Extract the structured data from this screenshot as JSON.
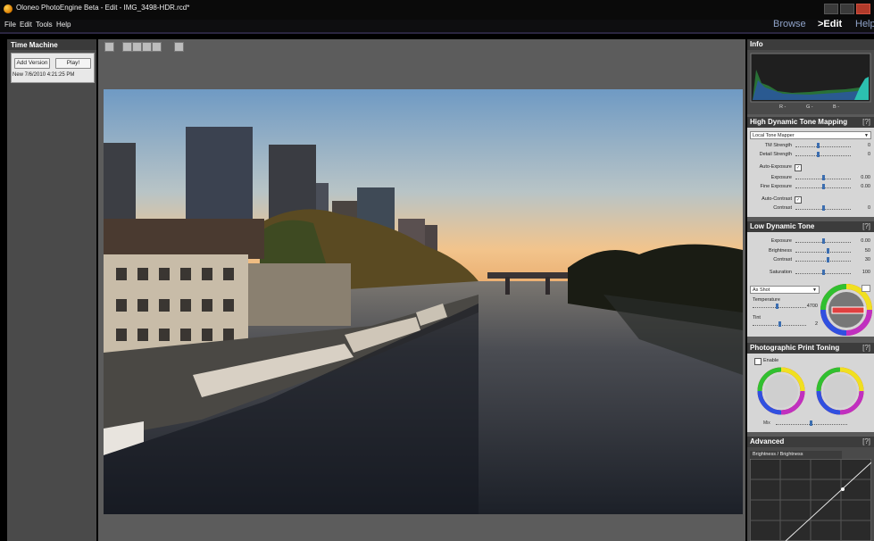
{
  "window": {
    "title": "Oloneo PhotoEngine Beta - Edit - IMG_3498-HDR.rcd*"
  },
  "menu": {
    "file": "File",
    "edit": "Edit",
    "tools": "Tools",
    "help": "Help"
  },
  "modes": {
    "browse": "Browse",
    "edit": ">Edit",
    "help": "Help"
  },
  "time_machine": {
    "title": "Time Machine",
    "add_version": "Add Version",
    "play": "Play!",
    "version_entry": "New 7/6/2010 4:21:25 PM"
  },
  "info": {
    "title": "Info",
    "hist_labels": [
      "R -",
      "G -",
      "B -"
    ]
  },
  "hdr": {
    "title": "High Dynamic Tone Mapping",
    "help": "[?]",
    "mapper": "Local Tone Mapper",
    "tm_strength": {
      "label": "TM Strength",
      "value": "0",
      "pos": 0.4
    },
    "detail_strength": {
      "label": "Detail Strength",
      "value": "0",
      "pos": 0.4
    },
    "auto_exposure": {
      "label": "Auto-Exposure",
      "checked": "✓"
    },
    "exposure": {
      "label": "Exposure",
      "value": "0.00",
      "pos": 0.5
    },
    "fine_exposure": {
      "label": "Fine Exposure",
      "value": "0.00",
      "pos": 0.5
    },
    "auto_contrast": {
      "label": "Auto-Contrast",
      "checked": "✓"
    },
    "contrast": {
      "label": "Contrast",
      "value": "0",
      "pos": 0.5
    }
  },
  "ldr": {
    "title": "Low Dynamic Tone",
    "help": "[?]",
    "exposure": {
      "label": "Exposure",
      "value": "0.00",
      "pos": 0.5
    },
    "brightness": {
      "label": "Brightness",
      "value": "50",
      "pos": 0.6
    },
    "contrast": {
      "label": "Contrast",
      "value": "30",
      "pos": 0.6
    },
    "saturation": {
      "label": "Saturation",
      "value": "100",
      "pos": 0.5
    },
    "wb_preset": "As Shot",
    "temperature": {
      "label": "Temperature",
      "value": "4700",
      "pos": 0.45
    },
    "tint": {
      "label": "Tint",
      "value": "2",
      "pos": 0.5
    }
  },
  "print_toning": {
    "title": "Photographic Print Toning",
    "help": "[?]",
    "enable": "Enable",
    "mix_label": "Mix"
  },
  "advanced": {
    "title": "Advanced",
    "help": "[?]",
    "tab": "Brightness / Brightness"
  },
  "colors": {
    "accent": "#3c6eb0",
    "panel": "#d6d6d6",
    "header": "#3c3c3c"
  }
}
